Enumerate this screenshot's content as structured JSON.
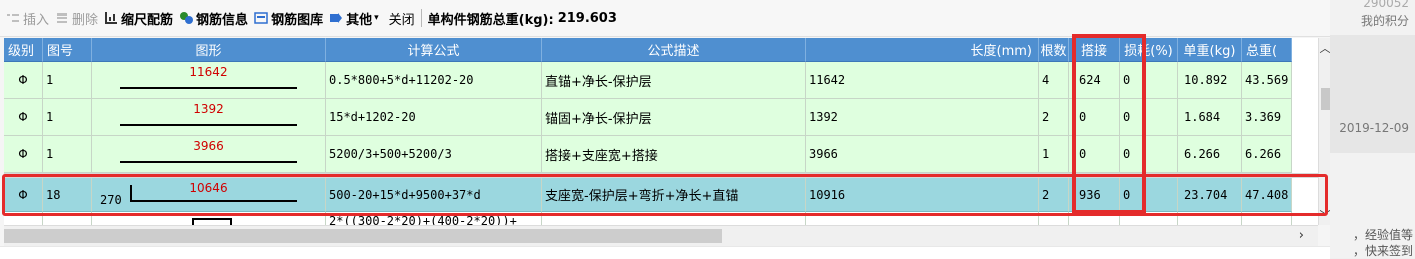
{
  "toolbar": {
    "insert": "插入",
    "delete": "删除",
    "scale_rebar": "缩尺配筋",
    "rebar_info": "钢筋信息",
    "rebar_library": "钢筋图库",
    "other": "其他",
    "close": "关闭",
    "total_label": "单构件钢筋总重(kg):",
    "total_value": "219.603"
  },
  "columns": [
    "级别",
    "图号",
    "图形",
    "计算公式",
    "公式描述",
    "长度(mm)",
    "根数",
    "搭接",
    "损耗(%)",
    "单重(kg)",
    "总重("
  ],
  "rows": [
    {
      "grade": "Φ",
      "fig_no": "1",
      "shape_len": "11642",
      "formula": "0.5*800+5*d+11202-20",
      "desc": "直锚+净长-保护层",
      "length": "11642",
      "count": "4",
      "lap": "624",
      "loss": "0",
      "unit_w": "10.892",
      "total_w": "43.569"
    },
    {
      "grade": "Φ",
      "fig_no": "1",
      "shape_len": "1392",
      "formula": "15*d+1202-20",
      "desc": "锚固+净长-保护层",
      "length": "1392",
      "count": "2",
      "lap": "0",
      "loss": "0",
      "unit_w": "1.684",
      "total_w": "3.369"
    },
    {
      "grade": "Φ",
      "fig_no": "1",
      "shape_len": "3966",
      "formula": "5200/3+500+5200/3",
      "desc": "搭接+支座宽+搭接",
      "length": "3966",
      "count": "1",
      "lap": "0",
      "loss": "0",
      "unit_w": "6.266",
      "total_w": "6.266"
    },
    {
      "grade": "Φ",
      "fig_no": "18",
      "shape_lead": "270",
      "shape_len": "10646",
      "formula": "500-20+15*d+9500+37*d",
      "desc": "支座宽-保护层+弯折+净长+直锚",
      "length": "10916",
      "count": "2",
      "lap": "936",
      "loss": "0",
      "unit_w": "23.704",
      "total_w": "47.408"
    }
  ],
  "partial_row": {
    "formula": "2*((300-2*20)+(400-2*20))+"
  },
  "side": {
    "top": "290052",
    "points": "我的积分",
    "date": "2019-12-09",
    "line1": "，经验值等",
    "line2": "，快来签到"
  },
  "colors": {
    "header_bg": "#4f8fd0",
    "row_green": "#dfffdf",
    "row_selected": "#9bd7df",
    "highlight_red": "#e42b2b",
    "shape_text": "#d00000"
  }
}
